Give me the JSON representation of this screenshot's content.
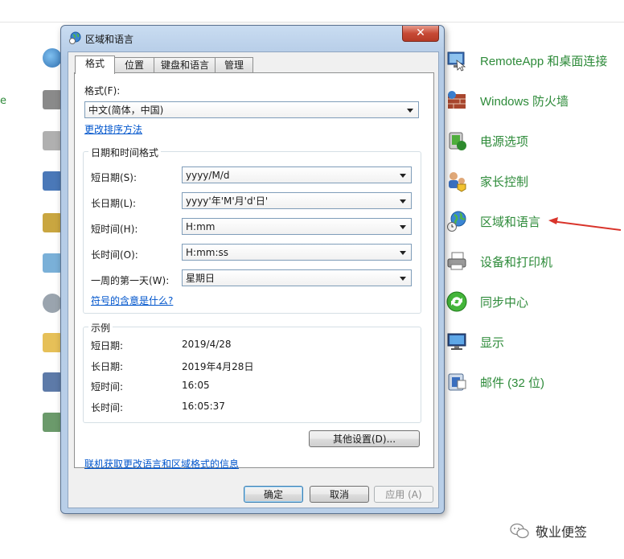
{
  "background": {
    "left_partial_text": "e",
    "items": [
      {
        "label": "RemoteApp 和桌面连接",
        "icon": "remoteapp-icon"
      },
      {
        "label": "Windows 防火墙",
        "icon": "firewall-icon"
      },
      {
        "label": "电源选项",
        "icon": "power-options-icon"
      },
      {
        "label": "家长控制",
        "icon": "parental-control-icon"
      },
      {
        "label": "区域和语言",
        "icon": "region-globe-icon"
      },
      {
        "label": "设备和打印机",
        "icon": "printer-icon"
      },
      {
        "label": "同步中心",
        "icon": "sync-center-icon"
      },
      {
        "label": "显示",
        "icon": "display-icon"
      },
      {
        "label": "邮件 (32 位)",
        "icon": "mail-icon"
      }
    ],
    "arrow_color": "#d9342b"
  },
  "dialog": {
    "title": "区域和语言",
    "close_label": "✕",
    "tabs": [
      {
        "label": "格式"
      },
      {
        "label": "位置"
      },
      {
        "label": "键盘和语言"
      },
      {
        "label": "管理"
      }
    ],
    "format_label": "格式(F):",
    "format_value": "中文(简体，中国)",
    "change_sort_link": "更改排序方法",
    "datetime_group_title": "日期和时间格式",
    "rows": [
      {
        "label": "短日期(S):",
        "value": "yyyy/M/d"
      },
      {
        "label": "长日期(L):",
        "value": "yyyy'年'M'月'd'日'"
      },
      {
        "label": "短时间(H):",
        "value": "H:mm"
      },
      {
        "label": "长时间(O):",
        "value": "H:mm:ss"
      },
      {
        "label": "一周的第一天(W):",
        "value": "星期日"
      }
    ],
    "symbols_link": "符号的含意是什么?",
    "example_group_title": "示例",
    "examples": [
      {
        "label": "短日期:",
        "value": "2019/4/28"
      },
      {
        "label": "长日期:",
        "value": "2019年4月28日"
      },
      {
        "label": "短时间:",
        "value": "16:05"
      },
      {
        "label": "长时间:",
        "value": "16:05:37"
      }
    ],
    "other_settings_button": "其他设置(D)...",
    "online_info_link": "联机获取更改语言和区域格式的信息",
    "ok_button": "确定",
    "cancel_button": "取消",
    "apply_button": "应用 (A)"
  },
  "watermark": {
    "text": "敬业便签"
  }
}
